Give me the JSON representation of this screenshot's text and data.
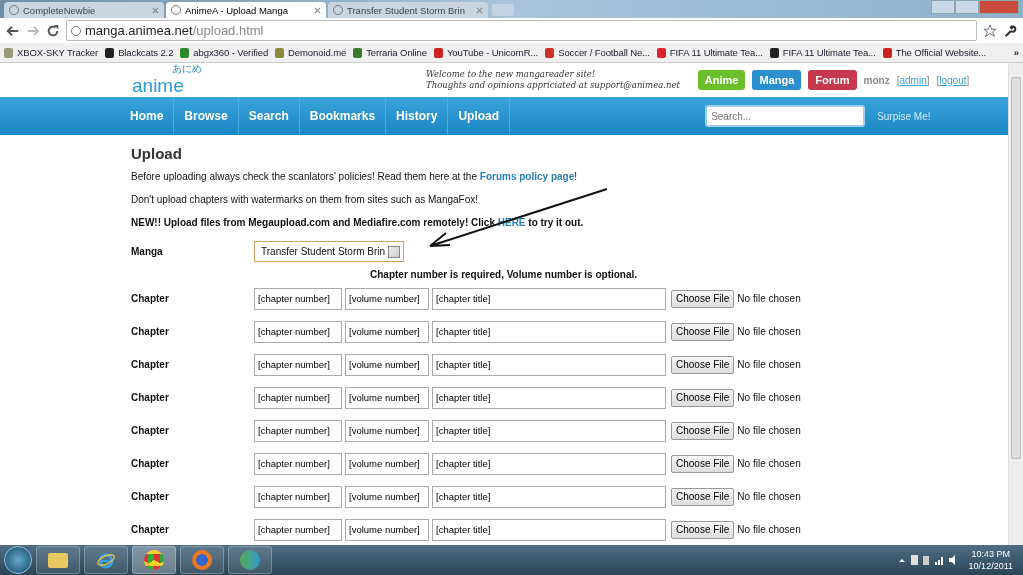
{
  "browser": {
    "tabs": [
      {
        "title": "CompleteNewbie",
        "selected": false
      },
      {
        "title": "AnimeA - Upload Manga",
        "selected": true
      },
      {
        "title": "Transfer Student Storm Brin",
        "selected": false
      }
    ],
    "address": {
      "host": "manga.animea.net",
      "path": "/upload.html"
    },
    "bookmarks": [
      {
        "label": "XBOX-SKY Tracker",
        "color": "#9a9a7a"
      },
      {
        "label": "Blackcats 2.2",
        "color": "#222222"
      },
      {
        "label": "abgx360 - Verified",
        "color": "#2a8a2a"
      },
      {
        "label": "Demonoid.me",
        "color": "#8a8a3a"
      },
      {
        "label": "Terraria Online",
        "color": "#3a7a2a"
      },
      {
        "label": "YouTube - UnicornR...",
        "color": "#cc2222"
      },
      {
        "label": "Soccer / Football Ne...",
        "color": "#cc3322"
      },
      {
        "label": "FIFA 11 Ultimate Tea...",
        "color": "#dd2233"
      },
      {
        "label": "FIFA 11 Ultimate Tea...",
        "color": "#222222"
      },
      {
        "label": "The Official Website...",
        "color": "#cc2222"
      }
    ],
    "more": "»"
  },
  "site": {
    "logo": "anime",
    "logo_kana": "あにめ",
    "welcome": [
      "Welcome to the new mangareader site!",
      "Thoughts and opinions appriciated at support@animea.net"
    ],
    "header_buttons": [
      {
        "label": "Anime",
        "color": "#6bbf2a"
      },
      {
        "label": "Manga",
        "color": "#2a8fcf"
      },
      {
        "label": "Forum",
        "color": "#c8384e"
      }
    ],
    "user": "monz",
    "user_links": [
      "admin",
      "logout"
    ],
    "bracket_open": "[",
    "bracket_close": "]",
    "nav": [
      "Home",
      "Browse",
      "Search",
      "Bookmarks",
      "History",
      "Upload"
    ],
    "search_placeholder": "Search...",
    "surprise": "Surpise Me!"
  },
  "content": {
    "title": "Upload",
    "policy": {
      "before": "Before uploading always check the scanlators' policies! Read them here at the ",
      "link": "Forums policy page",
      "after": "!"
    },
    "watermark_note": "Don't upload chapters with watermarks on them from sites such as MangaFox!",
    "remote": {
      "before": "NEW!! Upload files from Megaupload.com and Mediafire.com remotely! Click ",
      "link": "HERE",
      "after": " to try it out."
    },
    "manga": {
      "label": "Manga",
      "value": "Transfer Student Storm Brin"
    },
    "requirement": "Chapter number is required, Volume number is optional.",
    "rows": [
      {
        "label": "Chapter",
        "chapter": "[chapter number]",
        "volume": "[volume number]",
        "title": "[chapter title]",
        "button": "Choose File",
        "file": "No file chosen"
      },
      {
        "label": "Chapter",
        "chapter": "[chapter number]",
        "volume": "[volume number]",
        "title": "[chapter title]",
        "button": "Choose File",
        "file": "No file chosen"
      },
      {
        "label": "Chapter",
        "chapter": "[chapter number]",
        "volume": "[volume number]",
        "title": "[chapter title]",
        "button": "Choose File",
        "file": "No file chosen"
      },
      {
        "label": "Chapter",
        "chapter": "[chapter number]",
        "volume": "[volume number]",
        "title": "[chapter title]",
        "button": "Choose File",
        "file": "No file chosen"
      },
      {
        "label": "Chapter",
        "chapter": "[chapter number]",
        "volume": "[volume number]",
        "title": "[chapter title]",
        "button": "Choose File",
        "file": "No file chosen"
      },
      {
        "label": "Chapter",
        "chapter": "[chapter number]",
        "volume": "[volume number]",
        "title": "[chapter title]",
        "button": "Choose File",
        "file": "No file chosen"
      },
      {
        "label": "Chapter",
        "chapter": "[chapter number]",
        "volume": "[volume number]",
        "title": "[chapter title]",
        "button": "Choose File",
        "file": "No file chosen"
      },
      {
        "label": "Chapter",
        "chapter": "[chapter number]",
        "volume": "[volume number]",
        "title": "[chapter title]",
        "button": "Choose File",
        "file": "No file chosen"
      }
    ]
  },
  "taskbar": {
    "time": "10:43 PM",
    "date": "10/12/2011"
  }
}
